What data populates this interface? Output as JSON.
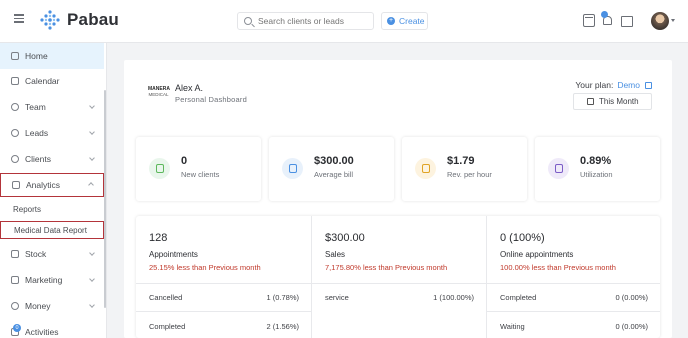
{
  "app": {
    "name": "Pabau"
  },
  "header": {
    "search_placeholder": "Search clients or leads",
    "create_label": "Create",
    "create_plus": "+",
    "icons": [
      "menu-icon",
      "calendar-icon",
      "bell-icon",
      "folder-icon",
      "avatar"
    ]
  },
  "sidebar": {
    "items": [
      {
        "label": "Home",
        "icon": "home-icon",
        "active": true
      },
      {
        "label": "Calendar",
        "icon": "calendar-icon"
      },
      {
        "label": "Team",
        "icon": "team-icon",
        "expandable": true
      },
      {
        "label": "Leads",
        "icon": "leads-icon",
        "expandable": true
      },
      {
        "label": "Clients",
        "icon": "clients-icon",
        "expandable": true
      },
      {
        "label": "Analytics",
        "icon": "analytics-icon",
        "expandable": true,
        "expanded": true
      },
      {
        "label": "Stock",
        "icon": "stock-icon",
        "expandable": true
      },
      {
        "label": "Marketing",
        "icon": "marketing-icon",
        "expandable": true
      },
      {
        "label": "Money",
        "icon": "money-icon",
        "expandable": true
      },
      {
        "label": "Activities",
        "icon": "activities-icon",
        "badge": "0"
      }
    ],
    "analytics_sub": [
      {
        "label": "Reports"
      },
      {
        "label": "Medical Data Report"
      }
    ]
  },
  "profile": {
    "logo_text": "MANERA",
    "logo_sub": "MEDICAL",
    "name": "Alex A.",
    "subtitle": "Personal Dashboard"
  },
  "plan": {
    "label": "Your plan:",
    "value": "Demo",
    "period": "This Month"
  },
  "cards": [
    {
      "value": "0",
      "label": "New clients",
      "icon": "people-icon",
      "color": "#5cb85c",
      "bg": "#e9f6ec"
    },
    {
      "value": "$300.00",
      "label": "Average bill",
      "icon": "bill-icon",
      "color": "#4a90e2",
      "bg": "#e8f1fb"
    },
    {
      "value": "$1.79",
      "label": "Rev. per hour",
      "icon": "revenue-icon",
      "color": "#e0a324",
      "bg": "#fdf3df"
    },
    {
      "value": "0.89%",
      "label": "Utilization",
      "icon": "utilization-icon",
      "color": "#7b5cc7",
      "bg": "#efeaf9"
    }
  ],
  "stats": [
    {
      "value": "128",
      "title": "Appointments",
      "comparison": "25.15% less than Previous month",
      "rows": [
        {
          "label": "Cancelled",
          "value": "1 (0.78%)"
        },
        {
          "label": "Completed",
          "value": "2 (1.56%)"
        }
      ]
    },
    {
      "value": "$300.00",
      "title": "Sales",
      "comparison": "7,175.80% less than Previous month",
      "rows": [
        {
          "label": "service",
          "value": "1 (100.00%)"
        }
      ]
    },
    {
      "value": "0 (100%)",
      "title": "Online appointments",
      "comparison": "100.00% less than Previous month",
      "rows": [
        {
          "label": "Completed",
          "value": "0 (0.00%)"
        },
        {
          "label": "Waiting",
          "value": "0 (0.00%)"
        }
      ]
    }
  ],
  "colors": {
    "accent": "#4a90e2",
    "negative": "#c0392b",
    "highlight_box": "#b3343a"
  }
}
